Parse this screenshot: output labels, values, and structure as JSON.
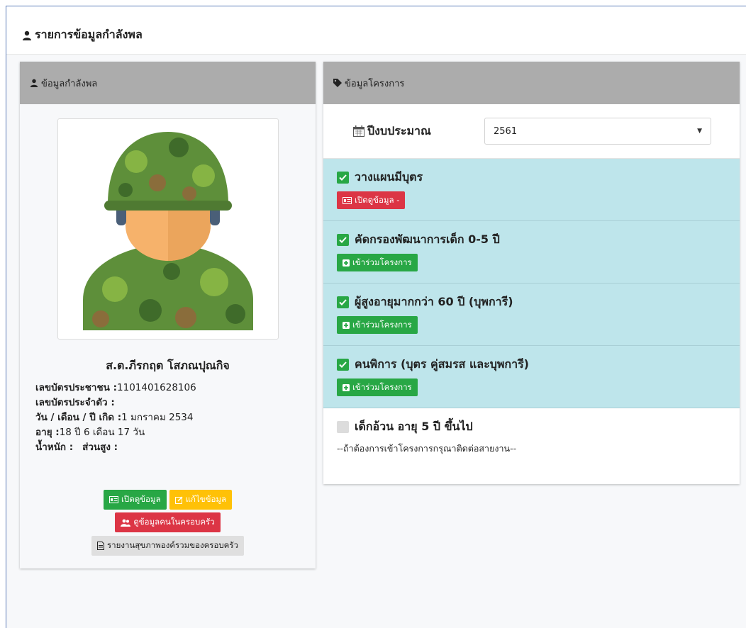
{
  "page": {
    "title": "รายการข้อมูลกำลังพล"
  },
  "left_card": {
    "title": "ข้อมูลกำลังพล",
    "name": "ส.ต.ภีรกฤต โสภณปุณกิจ",
    "fields": [
      {
        "label": "เลขบัตรประชาชน :",
        "value": "1101401628106"
      },
      {
        "label": "เลขบัตรประจำตัว :",
        "value": ""
      },
      {
        "label": "วัน / เดือน / ปี เกิด :",
        "value": "1 มกราคม 2534"
      },
      {
        "label": "อายุ :",
        "value": "18 ปี 6 เดือน 17 วัน"
      }
    ],
    "weight_label": "น้ำหนัก :",
    "height_label": "ส่วนสูง :",
    "buttons": {
      "view": "เปิดดูข้อมูล",
      "edit": "แก้ไขข้อมูล",
      "family": "ดูข้อมูลคนในครอบครัว",
      "report": "รายงานสุขภาพองค์รวมของครอบครัว"
    }
  },
  "right_card": {
    "title": "ข้อมูลโครงการ",
    "budget_label": "ปีงบประมาณ",
    "budget_value": "2561",
    "projects": [
      {
        "title": "วางแผนมีบุตร",
        "checked": true,
        "button": "เปิดดูข้อมูล -",
        "button_color": "#dc3545"
      },
      {
        "title": "คัดกรองพัฒนาการเด็ก 0-5 ปี",
        "checked": true,
        "button": "เข้าร่วมโครงการ",
        "button_color": "#28a745"
      },
      {
        "title": "ผู้สูงอายุมากกว่า 60 ปี (บุพการี)",
        "checked": true,
        "button": "เข้าร่วมโครงการ",
        "button_color": "#28a745"
      },
      {
        "title": "คนพิการ (บุตร คู่สมรส และบุพการี)",
        "checked": true,
        "button": "เข้าร่วมโครงการ",
        "button_color": "#28a745"
      }
    ],
    "extra_project": {
      "title": "เด็กอ้วน อายุ 5 ปี ขึ้นไป",
      "checked": false,
      "note": "--ถ้าต้องการเข้าโครงการกรุณาติดต่อสายงาน--"
    }
  },
  "colors": {
    "header_gray": "#acacac",
    "project_bg": "#bee5eb",
    "green": "#28a745",
    "red": "#dc3545",
    "yellow": "#ffc107"
  },
  "icons": [
    "user-icon",
    "tag-icon",
    "calendar-icon",
    "check-icon",
    "id-card-icon",
    "edit-icon",
    "users-icon",
    "file-icon",
    "plus-square-icon",
    "soldier-avatar"
  ]
}
